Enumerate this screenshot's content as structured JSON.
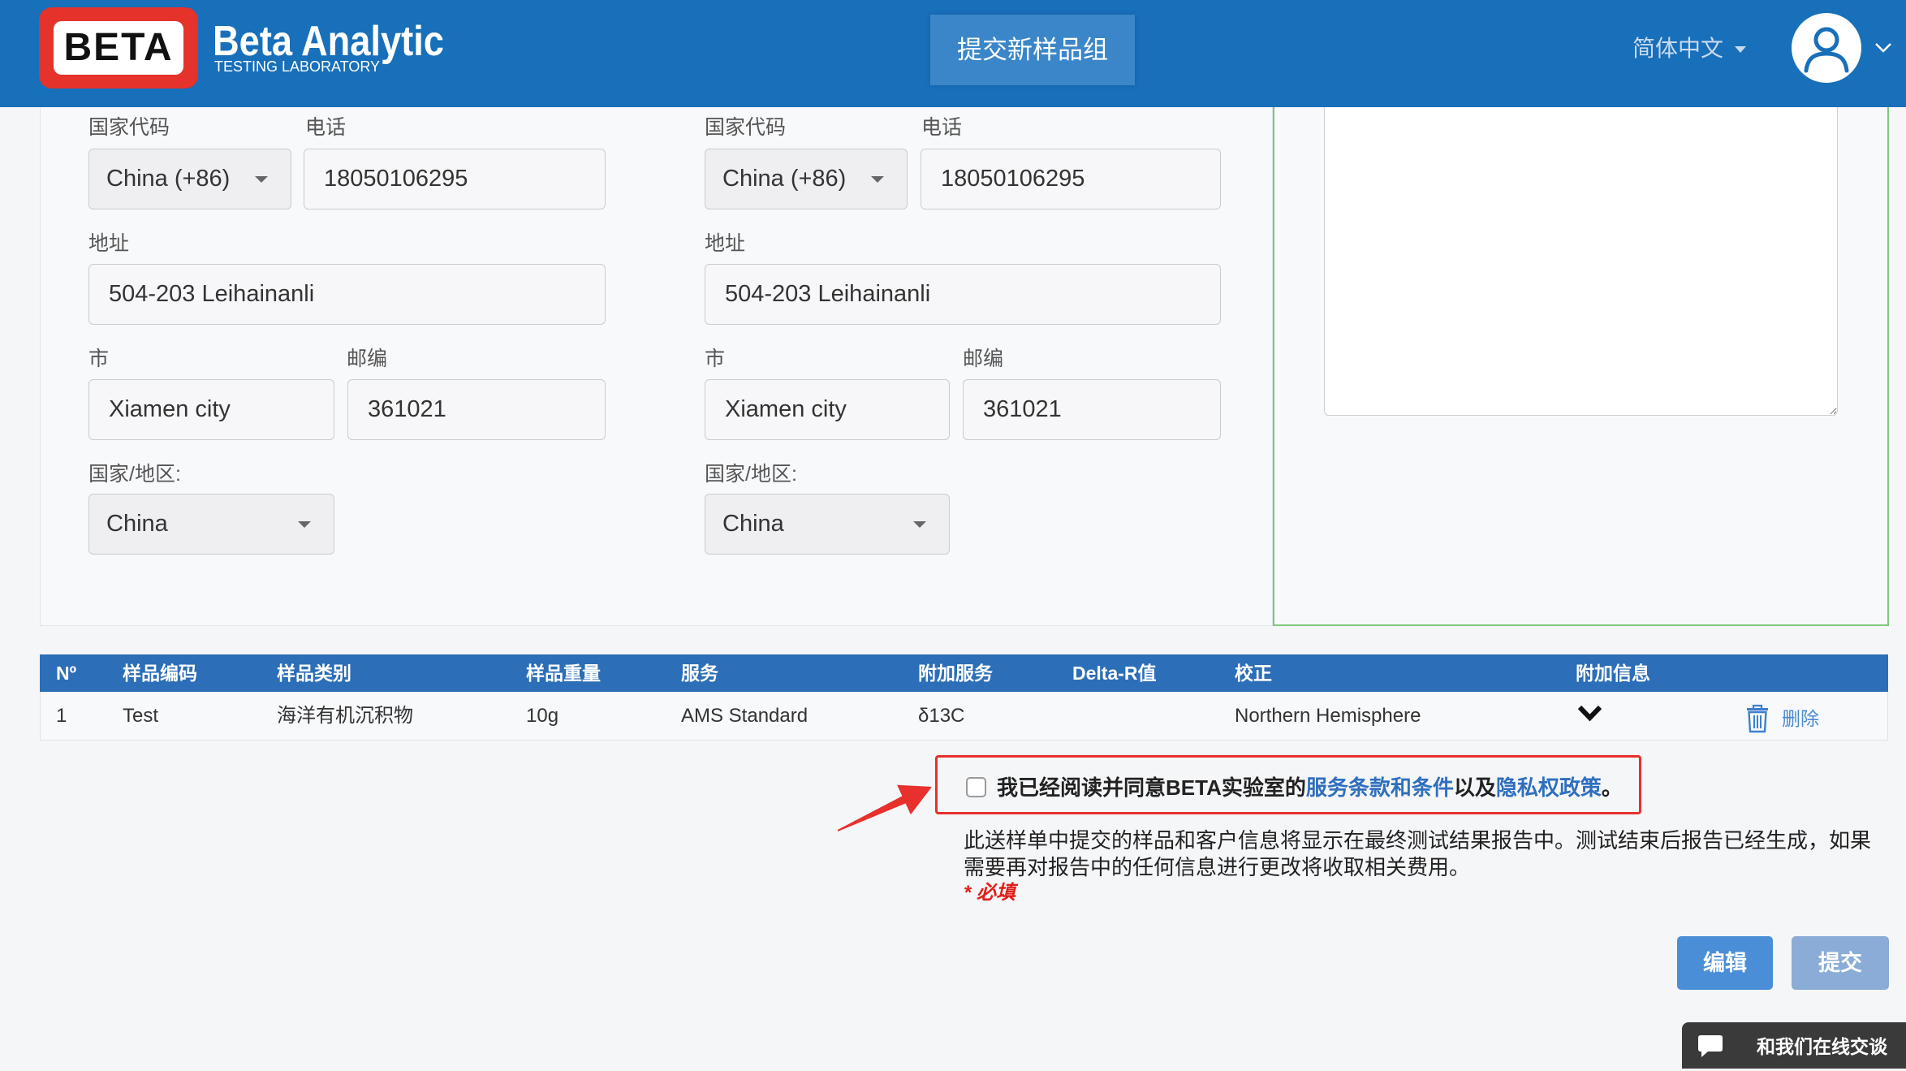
{
  "header": {
    "logo_text": "BETA",
    "brand_name": "Beta Analytic",
    "brand_tagline": "TESTING LABORATORY",
    "nav_tab": "提交新样品组",
    "language": "简体中文",
    "icons": {
      "language": "caret-down-icon",
      "avatar": "user-avatar-icon",
      "account_menu": "chevron-down-icon"
    }
  },
  "address_form_labels": {
    "country_code": "国家代码",
    "phone": "电话",
    "address": "地址",
    "city": "市",
    "postal_code": "邮编",
    "country_region": "国家/地区:"
  },
  "address_forms": [
    {
      "country_code": "China (+86)",
      "phone": "18050106295",
      "address": "504-203 Leihainanli",
      "city": "Xiamen city",
      "postal_code": "361021",
      "country_region": "China"
    },
    {
      "country_code": "China (+86)",
      "phone": "18050106295",
      "address": "504-203 Leihainanli",
      "city": "Xiamen city",
      "postal_code": "361021",
      "country_region": "China"
    }
  ],
  "samples_table": {
    "columns": [
      "Nº",
      "样品编码",
      "样品类别",
      "样品重量",
      "服务",
      "附加服务",
      "Delta-R值",
      "校正",
      "附加信息"
    ],
    "rows": [
      {
        "no": "1",
        "sample_code": "Test",
        "sample_type": "海洋有机沉积物",
        "weight": "10g",
        "service": "AMS Standard",
        "additional_service": "δ13C",
        "delta_r": "",
        "calibration": "Northern Hemisphere",
        "info_icon": "chevron-down-icon",
        "delete_icon": "trash-icon",
        "delete_label": "删除"
      }
    ]
  },
  "agreement": {
    "checked": false,
    "text_prefix": "我已经阅读并同意BETA实验室的",
    "terms_link": "服务条款和条件",
    "text_middle": "以及",
    "privacy_link": "隐私权政策",
    "text_suffix": "。"
  },
  "notice": "此送样单中提交的样品和客户信息将显示在最终测试结果报告中。测试结束后报告已经生成，如果需要再对报告中的任何信息进行更改将收取相关费用。",
  "required_note": "* 必填",
  "actions": {
    "edit": "编辑",
    "submit": "提交"
  },
  "chat": {
    "label": "和我们在线交谈",
    "icon": "chat-bubble-icon"
  },
  "theme": {
    "header_bg": "#186fba",
    "table_header_bg": "#2c6eb7",
    "link": "#2f6fbe",
    "primary_button": "#4a8ed7",
    "submit_button": "#8aacd6",
    "required": "#e0201b",
    "highlight": "#e8302c",
    "active_panel_border": "#7fc77f",
    "chat_bg": "#3a3a3a"
  }
}
